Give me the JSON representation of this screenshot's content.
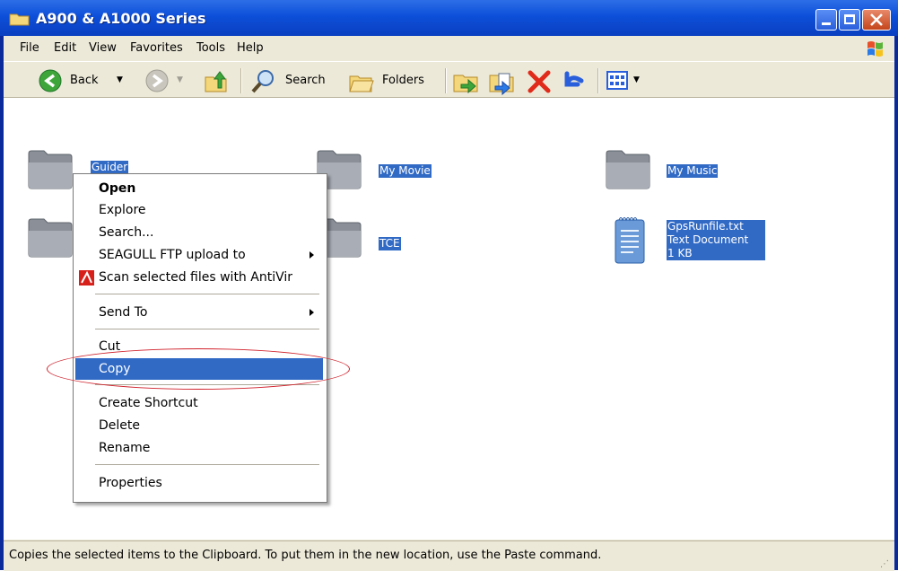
{
  "window": {
    "title": "A900 & A1000 Series",
    "accent": "#0a3fc0"
  },
  "menu": [
    "File",
    "Edit",
    "View",
    "Favorites",
    "Tools",
    "Help"
  ],
  "toolbar": {
    "back": "Back",
    "search": "Search",
    "folders": "Folders"
  },
  "items": [
    {
      "name": "Guider",
      "icon": "folder-icon"
    },
    {
      "name": "My Movie",
      "icon": "folder-icon"
    },
    {
      "name": "My Music",
      "icon": "folder-icon"
    },
    {
      "name": "TCE",
      "icon": "folder-icon"
    },
    {
      "name": "GpsRunfile.txt",
      "type": "Text Document",
      "size": "1 KB",
      "icon": "text-document-icon"
    }
  ],
  "context_menu": {
    "items": [
      {
        "label": "Open",
        "bold": true
      },
      {
        "label": "Explore"
      },
      {
        "label": "Search..."
      },
      {
        "label": "SEAGULL FTP upload to",
        "submenu": true
      },
      {
        "label": "Scan selected files with AntiVir",
        "icon": "antivir-icon"
      },
      {
        "label": "Send To",
        "submenu": true
      },
      {
        "label": "Cut"
      },
      {
        "label": "Copy",
        "highlighted": true
      },
      {
        "label": "Create Shortcut"
      },
      {
        "label": "Delete"
      },
      {
        "label": "Rename"
      },
      {
        "label": "Properties"
      }
    ],
    "highlight_color": "#316ac5",
    "annotation_color": "#d0202a"
  },
  "status": {
    "text": "Copies the selected items to the Clipboard. To put them in the new location, use the Paste command."
  }
}
